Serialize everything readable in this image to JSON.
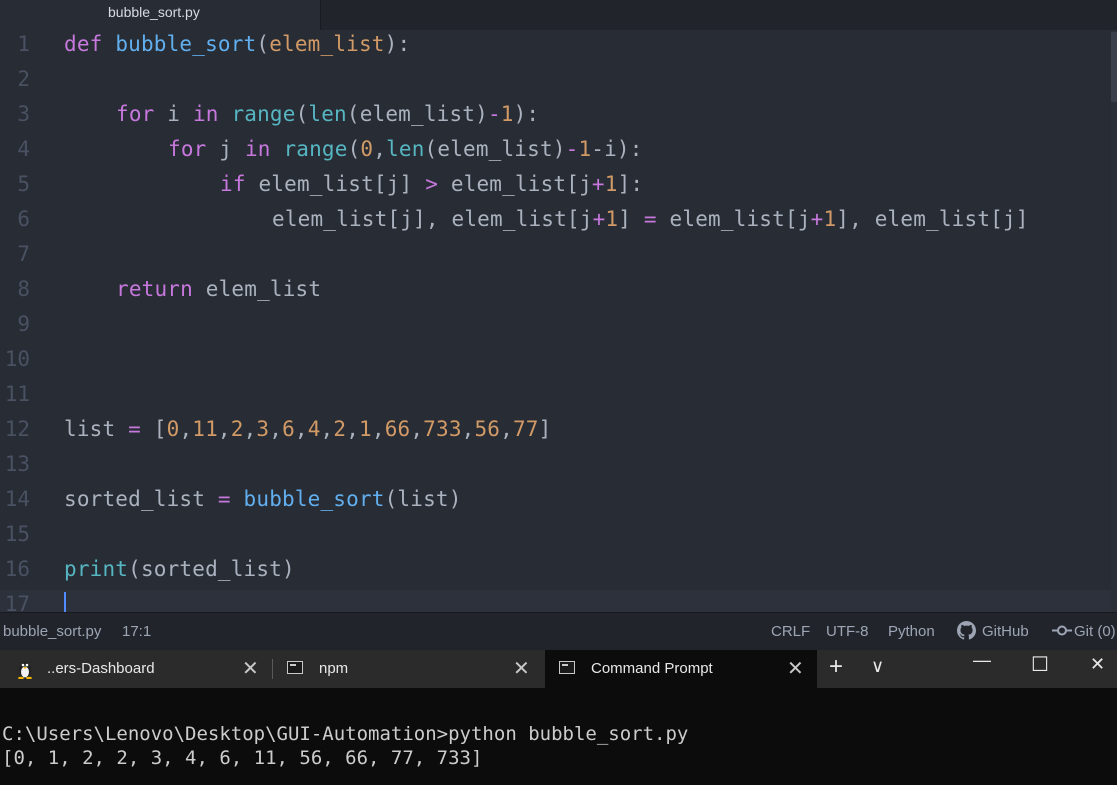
{
  "editor": {
    "tab_title": "bubble_sort.py",
    "lines": [
      {
        "n": "1"
      },
      {
        "n": "2"
      },
      {
        "n": "3"
      },
      {
        "n": "4"
      },
      {
        "n": "5"
      },
      {
        "n": "6"
      },
      {
        "n": "7"
      },
      {
        "n": "8"
      },
      {
        "n": "9"
      },
      {
        "n": "10"
      },
      {
        "n": "11"
      },
      {
        "n": "12"
      },
      {
        "n": "13"
      },
      {
        "n": "14"
      },
      {
        "n": "15"
      },
      {
        "n": "16"
      },
      {
        "n": "17"
      }
    ],
    "code": {
      "l1": [
        "def",
        " ",
        "bubble_sort",
        "(",
        "elem_list",
        "):"
      ],
      "l3": [
        "for",
        " i ",
        "in",
        " ",
        "range",
        "(",
        "len",
        "(elem_list)",
        "-",
        "1",
        "):"
      ],
      "l4": [
        "for",
        " j ",
        "in",
        " ",
        "range",
        "(",
        "0",
        ",",
        "len",
        "(elem_list)",
        "-",
        "1",
        "-i):"
      ],
      "l5": [
        "if",
        " elem_list[j] ",
        ">",
        " elem_list[j",
        "+",
        "1",
        "]:"
      ],
      "l6": [
        "elem_list[j], elem_list[j",
        "+",
        "1",
        "] ",
        "=",
        " elem_list[j",
        "+",
        "1",
        "], elem_list[j]"
      ],
      "l8": [
        "return",
        " elem_list"
      ],
      "l12": [
        "list ",
        "=",
        " [",
        "0",
        ",",
        "11",
        ",",
        "2",
        ",",
        "3",
        ",",
        "6",
        ",",
        "4",
        ",",
        "2",
        ",",
        "1",
        ",",
        "66",
        ",",
        "733",
        ",",
        "56",
        ",",
        "77",
        "]"
      ],
      "l14": [
        "sorted_list ",
        "=",
        " ",
        "bubble_sort",
        "(list)"
      ],
      "l16": [
        "print",
        "(sorted_list)"
      ]
    }
  },
  "statusbar": {
    "file": "bubble_sort.py",
    "cursor_pos": "17:1",
    "line_ending": "CRLF",
    "encoding": "UTF-8",
    "grammar": "Python",
    "github": "GitHub",
    "git": "Git (0)"
  },
  "terminal": {
    "tabs": [
      {
        "label": "..ers-Dashboard",
        "icon": "linux-penguin-icon"
      },
      {
        "label": "npm",
        "icon": "cmd-icon"
      },
      {
        "label": "Command Prompt",
        "icon": "cmd-icon"
      }
    ],
    "new_tab": "+",
    "dropdown": "∨",
    "minimize": "—",
    "maximize": "☐",
    "close": "✕",
    "tab_close": "✕",
    "output": [
      "C:\\Users\\Lenovo\\Desktop\\GUI-Automation>python bubble_sort.py",
      "[0, 1, 2, 2, 3, 4, 6, 11, 56, 66, 77, 733]"
    ]
  }
}
